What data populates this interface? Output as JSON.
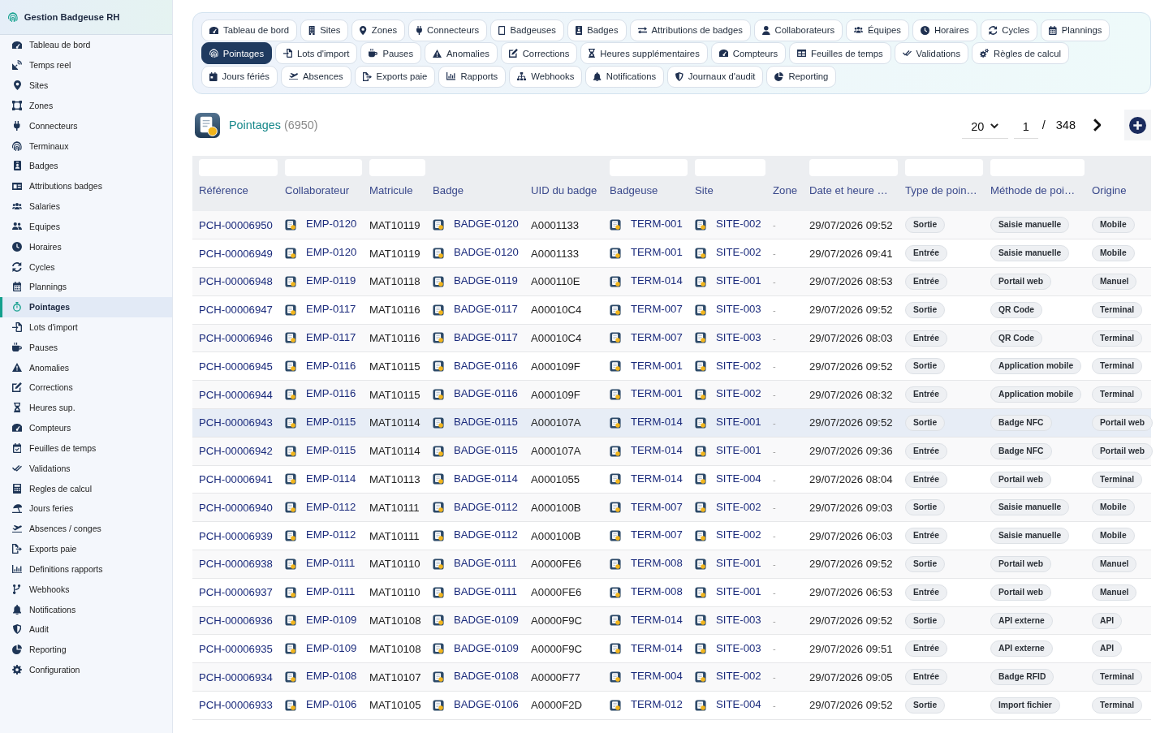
{
  "app": {
    "title": "Gestion Badgeuse RH"
  },
  "sidebar": {
    "items": [
      {
        "label": "Tableau de bord",
        "selected": false
      },
      {
        "label": "Temps reel",
        "selected": false
      },
      {
        "label": "Sites",
        "selected": false
      },
      {
        "label": "Zones",
        "selected": false
      },
      {
        "label": "Connecteurs",
        "selected": false
      },
      {
        "label": "Terminaux",
        "selected": false
      },
      {
        "label": "Badges",
        "selected": false
      },
      {
        "label": "Attributions badges",
        "selected": false
      },
      {
        "label": "Salaries",
        "selected": false
      },
      {
        "label": "Equipes",
        "selected": false
      },
      {
        "label": "Horaires",
        "selected": false
      },
      {
        "label": "Cycles",
        "selected": false
      },
      {
        "label": "Plannings",
        "selected": false
      },
      {
        "label": "Pointages",
        "selected": true
      },
      {
        "label": "Lots d'import",
        "selected": false
      },
      {
        "label": "Pauses",
        "selected": false
      },
      {
        "label": "Anomalies",
        "selected": false
      },
      {
        "label": "Corrections",
        "selected": false
      },
      {
        "label": "Heures sup.",
        "selected": false
      },
      {
        "label": "Compteurs",
        "selected": false
      },
      {
        "label": "Feuilles de temps",
        "selected": false
      },
      {
        "label": "Validations",
        "selected": false
      },
      {
        "label": "Regles de calcul",
        "selected": false
      },
      {
        "label": "Jours feries",
        "selected": false
      },
      {
        "label": "Absences / conges",
        "selected": false
      },
      {
        "label": "Exports paie",
        "selected": false
      },
      {
        "label": "Definitions rapports",
        "selected": false
      },
      {
        "label": "Webhooks",
        "selected": false
      },
      {
        "label": "Notifications",
        "selected": false
      },
      {
        "label": "Audit",
        "selected": false
      },
      {
        "label": "Reporting",
        "selected": false
      },
      {
        "label": "Configuration",
        "selected": false
      }
    ]
  },
  "tabs": [
    {
      "label": "Tableau de bord",
      "selected": false
    },
    {
      "label": "Sites",
      "selected": false
    },
    {
      "label": "Zones",
      "selected": false
    },
    {
      "label": "Connecteurs",
      "selected": false
    },
    {
      "label": "Badgeuses",
      "selected": false
    },
    {
      "label": "Badges",
      "selected": false
    },
    {
      "label": "Attributions de badges",
      "selected": false
    },
    {
      "label": "Collaborateurs",
      "selected": false
    },
    {
      "label": "Équipes",
      "selected": false
    },
    {
      "label": "Horaires",
      "selected": false
    },
    {
      "label": "Cycles",
      "selected": false
    },
    {
      "label": "Plannings",
      "selected": false
    },
    {
      "label": "Pointages",
      "selected": true
    },
    {
      "label": "Lots d'import",
      "selected": false
    },
    {
      "label": "Pauses",
      "selected": false
    },
    {
      "label": "Anomalies",
      "selected": false
    },
    {
      "label": "Corrections",
      "selected": false
    },
    {
      "label": "Heures supplémentaires",
      "selected": false
    },
    {
      "label": "Compteurs",
      "selected": false
    },
    {
      "label": "Feuilles de temps",
      "selected": false
    },
    {
      "label": "Validations",
      "selected": false
    },
    {
      "label": "Règles de calcul",
      "selected": false
    },
    {
      "label": "Jours fériés",
      "selected": false
    },
    {
      "label": "Absences",
      "selected": false
    },
    {
      "label": "Exports paie",
      "selected": false
    },
    {
      "label": "Rapports",
      "selected": false
    },
    {
      "label": "Webhooks",
      "selected": false
    },
    {
      "label": "Notifications",
      "selected": false
    },
    {
      "label": "Journaux d'audit",
      "selected": false
    },
    {
      "label": "Reporting",
      "selected": false
    }
  ],
  "list": {
    "title": "Pointages",
    "count": "(6950)",
    "page_size": "20",
    "page": "1",
    "separator": "/",
    "page_count": "348"
  },
  "table": {
    "columns": [
      {
        "label": "Référence",
        "kind": "link",
        "filter": true
      },
      {
        "label": "Collaborateur",
        "kind": "icon-link",
        "filter": true
      },
      {
        "label": "Matricule",
        "kind": "text",
        "filter": true
      },
      {
        "label": "Badge",
        "kind": "icon-link",
        "filter": false
      },
      {
        "label": "UID du badge",
        "kind": "text",
        "filter": false
      },
      {
        "label": "Badgeuse",
        "kind": "icon-link",
        "filter": true
      },
      {
        "label": "Site",
        "kind": "icon-link",
        "filter": true
      },
      {
        "label": "Zone",
        "kind": "muted",
        "filter": false
      },
      {
        "label": "Date et heure …",
        "kind": "text",
        "filter": true
      },
      {
        "label": "Type de poin…",
        "kind": "tag",
        "filter": true
      },
      {
        "label": "Méthode de poi…",
        "kind": "tag",
        "filter": true
      },
      {
        "label": "Origine",
        "kind": "tag",
        "filter": false
      }
    ],
    "rows": [
      {
        "selected": false,
        "cells": [
          "PCH-00006950",
          "EMP-0120",
          "MAT10119",
          "BADGE-0120",
          "A0001133",
          "TERM-001",
          "SITE-002",
          "-",
          "29/07/2026 09:52",
          "Sortie",
          "Saisie manuelle",
          "Mobile"
        ]
      },
      {
        "selected": false,
        "cells": [
          "PCH-00006949",
          "EMP-0120",
          "MAT10119",
          "BADGE-0120",
          "A0001133",
          "TERM-001",
          "SITE-002",
          "-",
          "29/07/2026 09:41",
          "Entrée",
          "Saisie manuelle",
          "Mobile"
        ]
      },
      {
        "selected": false,
        "cells": [
          "PCH-00006948",
          "EMP-0119",
          "MAT10118",
          "BADGE-0119",
          "A000110E",
          "TERM-014",
          "SITE-001",
          "-",
          "29/07/2026 08:53",
          "Entrée",
          "Portail web",
          "Manuel"
        ]
      },
      {
        "selected": false,
        "cells": [
          "PCH-00006947",
          "EMP-0117",
          "MAT10116",
          "BADGE-0117",
          "A00010C4",
          "TERM-007",
          "SITE-003",
          "-",
          "29/07/2026 09:52",
          "Sortie",
          "QR Code",
          "Terminal"
        ]
      },
      {
        "selected": false,
        "cells": [
          "PCH-00006946",
          "EMP-0117",
          "MAT10116",
          "BADGE-0117",
          "A00010C4",
          "TERM-007",
          "SITE-003",
          "-",
          "29/07/2026 08:03",
          "Entrée",
          "QR Code",
          "Terminal"
        ]
      },
      {
        "selected": false,
        "cells": [
          "PCH-00006945",
          "EMP-0116",
          "MAT10115",
          "BADGE-0116",
          "A000109F",
          "TERM-001",
          "SITE-002",
          "-",
          "29/07/2026 09:52",
          "Sortie",
          "Application mobile",
          "Terminal"
        ]
      },
      {
        "selected": false,
        "cells": [
          "PCH-00006944",
          "EMP-0116",
          "MAT10115",
          "BADGE-0116",
          "A000109F",
          "TERM-001",
          "SITE-002",
          "-",
          "29/07/2026 08:32",
          "Entrée",
          "Application mobile",
          "Terminal"
        ]
      },
      {
        "selected": true,
        "cells": [
          "PCH-00006943",
          "EMP-0115",
          "MAT10114",
          "BADGE-0115",
          "A000107A",
          "TERM-014",
          "SITE-001",
          "-",
          "29/07/2026 09:52",
          "Sortie",
          "Badge NFC",
          "Portail web"
        ]
      },
      {
        "selected": false,
        "cells": [
          "PCH-00006942",
          "EMP-0115",
          "MAT10114",
          "BADGE-0115",
          "A000107A",
          "TERM-014",
          "SITE-001",
          "-",
          "29/07/2026 09:36",
          "Entrée",
          "Badge NFC",
          "Portail web"
        ]
      },
      {
        "selected": false,
        "cells": [
          "PCH-00006941",
          "EMP-0114",
          "MAT10113",
          "BADGE-0114",
          "A0001055",
          "TERM-014",
          "SITE-004",
          "-",
          "29/07/2026 08:04",
          "Entrée",
          "Portail web",
          "Terminal"
        ]
      },
      {
        "selected": false,
        "cells": [
          "PCH-00006940",
          "EMP-0112",
          "MAT10111",
          "BADGE-0112",
          "A000100B",
          "TERM-007",
          "SITE-002",
          "-",
          "29/07/2026 09:03",
          "Sortie",
          "Saisie manuelle",
          "Mobile"
        ]
      },
      {
        "selected": false,
        "cells": [
          "PCH-00006939",
          "EMP-0112",
          "MAT10111",
          "BADGE-0112",
          "A000100B",
          "TERM-007",
          "SITE-002",
          "-",
          "29/07/2026 06:03",
          "Entrée",
          "Saisie manuelle",
          "Mobile"
        ]
      },
      {
        "selected": false,
        "cells": [
          "PCH-00006938",
          "EMP-0111",
          "MAT10110",
          "BADGE-0111",
          "A0000FE6",
          "TERM-008",
          "SITE-001",
          "-",
          "29/07/2026 09:52",
          "Sortie",
          "Portail web",
          "Manuel"
        ]
      },
      {
        "selected": false,
        "cells": [
          "PCH-00006937",
          "EMP-0111",
          "MAT10110",
          "BADGE-0111",
          "A0000FE6",
          "TERM-008",
          "SITE-001",
          "-",
          "29/07/2026 06:53",
          "Entrée",
          "Portail web",
          "Manuel"
        ]
      },
      {
        "selected": false,
        "cells": [
          "PCH-00006936",
          "EMP-0109",
          "MAT10108",
          "BADGE-0109",
          "A0000F9C",
          "TERM-014",
          "SITE-003",
          "-",
          "29/07/2026 09:52",
          "Sortie",
          "API externe",
          "API"
        ]
      },
      {
        "selected": false,
        "cells": [
          "PCH-00006935",
          "EMP-0109",
          "MAT10108",
          "BADGE-0109",
          "A0000F9C",
          "TERM-014",
          "SITE-003",
          "-",
          "29/07/2026 09:51",
          "Entrée",
          "API externe",
          "API"
        ]
      },
      {
        "selected": false,
        "cells": [
          "PCH-00006934",
          "EMP-0108",
          "MAT10107",
          "BADGE-0108",
          "A0000F77",
          "TERM-004",
          "SITE-002",
          "-",
          "29/07/2026 09:05",
          "Entrée",
          "Badge RFID",
          "Terminal"
        ]
      },
      {
        "selected": false,
        "cells": [
          "PCH-00006933",
          "EMP-0106",
          "MAT10105",
          "BADGE-0106",
          "A0000F2D",
          "TERM-012",
          "SITE-004",
          "-",
          "29/07/2026 09:52",
          "Sortie",
          "Import fichier",
          "Terminal"
        ]
      }
    ]
  }
}
